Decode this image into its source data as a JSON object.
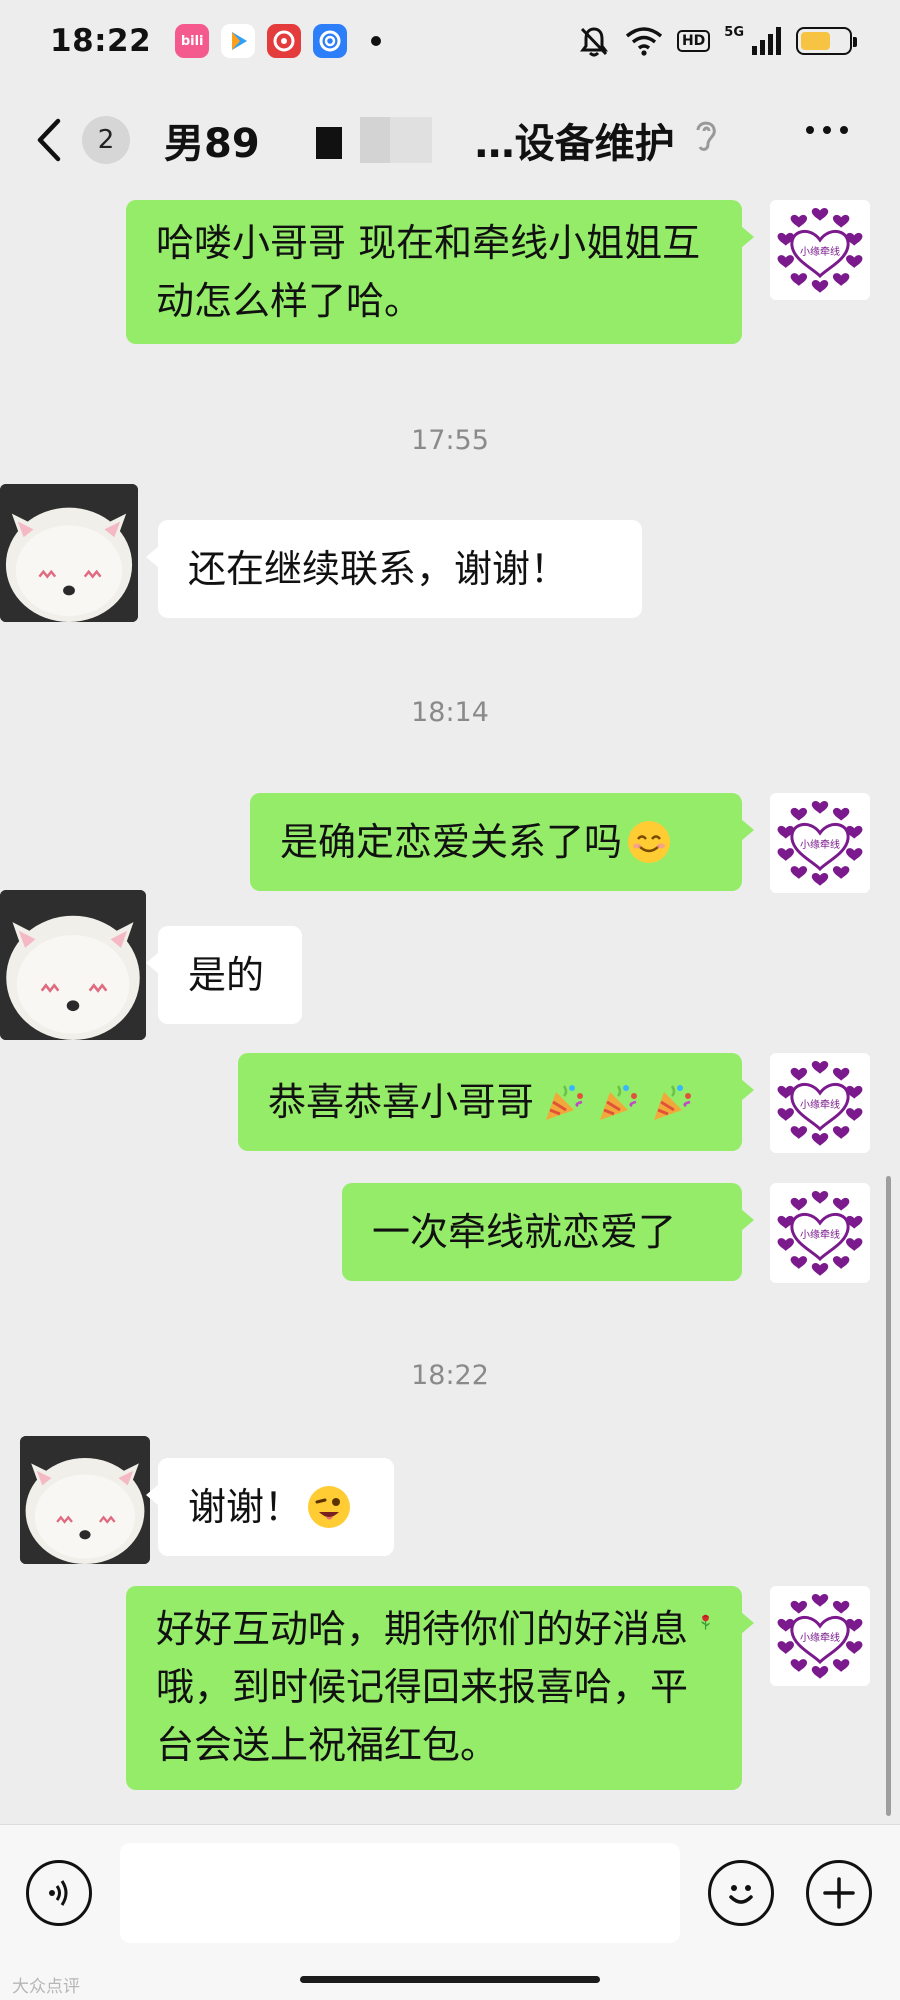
{
  "status_bar": {
    "time": "18:22",
    "apps": [
      {
        "icon": "bilibili-icon",
        "label": "bili",
        "color": "#f45a8d"
      },
      {
        "icon": "video-app-icon",
        "label": "▶",
        "color": "#ffffff"
      },
      {
        "icon": "netease-music-icon",
        "label": "◎",
        "color": "#e43c3c"
      },
      {
        "icon": "browser-icon",
        "label": "e",
        "color": "#2d7ff9"
      }
    ],
    "hd": "HD",
    "network": "5G",
    "battery_level": 0.62
  },
  "nav": {
    "unread_count": "2",
    "title_prefix": "男89",
    "title_suffix": "…设备维护"
  },
  "avatar_me_text": "小缘牵线",
  "messages": [
    {
      "type": "text",
      "side": "right",
      "text": "哈喽小哥哥 现在和牵线小姐姐互动怎么样了哈。"
    },
    {
      "type": "time",
      "text": "17:55"
    },
    {
      "type": "text",
      "side": "left",
      "text": "还在继续联系，谢谢！"
    },
    {
      "type": "time",
      "text": "18:14"
    },
    {
      "type": "text",
      "side": "right",
      "text": "是确定恋爱关系了吗",
      "emoji": "smile-emoji"
    },
    {
      "type": "text",
      "side": "left",
      "text": "是的"
    },
    {
      "type": "text",
      "side": "right",
      "text": "恭喜恭喜小哥哥",
      "emoji": "party-popper-emoji x3"
    },
    {
      "type": "text",
      "side": "right",
      "text": "一次牵线就恋爱了"
    },
    {
      "type": "time",
      "text": "18:22"
    },
    {
      "type": "text",
      "side": "left",
      "text": "谢谢！",
      "emoji": "wink-emoji"
    },
    {
      "type": "text",
      "side": "right",
      "text": "好好互动哈，期待你们的好消息哦，到时候记得回来报喜哈，平台会送上祝福红包。",
      "emoji": "rose-emoji"
    }
  ],
  "watermark": "大众点评",
  "colors": {
    "background": "#ededed",
    "bubble_right": "#95ec69",
    "bubble_left": "#ffffff",
    "heart_purple": "#7a1a8c"
  }
}
